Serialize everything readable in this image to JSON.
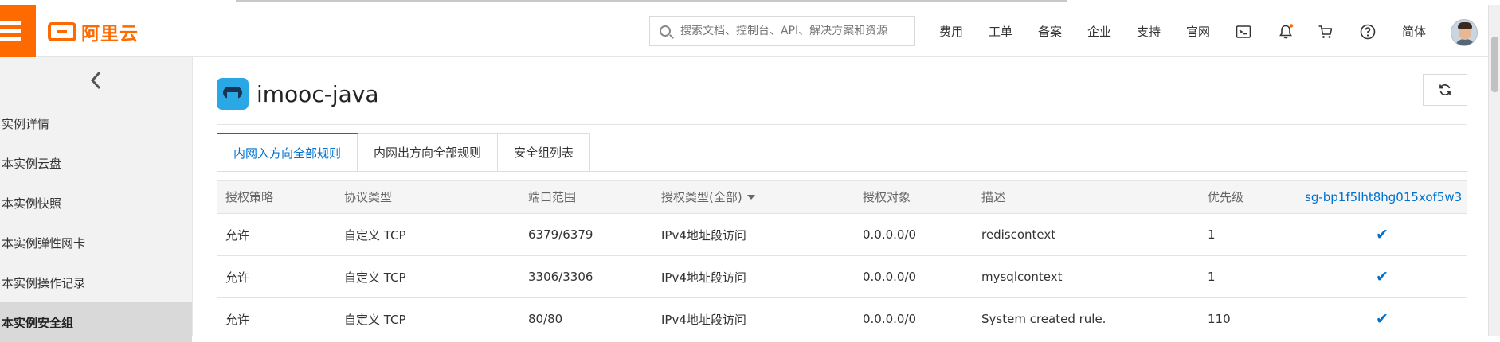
{
  "header": {
    "logo_text": "阿里云",
    "search_placeholder": "搜索文档、控制台、API、解决方案和资源",
    "nav": [
      "费用",
      "工单",
      "备案",
      "企业",
      "支持",
      "官网"
    ],
    "language": "简体",
    "accent_color": "#ff6a00"
  },
  "sidebar": {
    "items": [
      {
        "label": "实例详情"
      },
      {
        "label": "本实例云盘"
      },
      {
        "label": "本实例快照"
      },
      {
        "label": "本实例弹性网卡"
      },
      {
        "label": "本实例操作记录"
      },
      {
        "label": "本实例安全组"
      }
    ]
  },
  "main": {
    "title": "imooc-java",
    "tabs": [
      {
        "label": "内网入方向全部规则"
      },
      {
        "label": "内网出方向全部规则"
      },
      {
        "label": "安全组列表"
      }
    ],
    "table": {
      "headers": [
        "授权策略",
        "协议类型",
        "端口范围",
        "授权类型(全部)",
        "授权对象",
        "描述",
        "优先级",
        "sg-bp1f5lht8hg015xof5w3"
      ],
      "rows": [
        [
          "允许",
          "自定义 TCP",
          "6379/6379",
          "IPv4地址段访问",
          "0.0.0.0/0",
          "rediscontext",
          "1"
        ],
        [
          "允许",
          "自定义 TCP",
          "3306/3306",
          "IPv4地址段访问",
          "0.0.0.0/0",
          "mysqlcontext",
          "1"
        ],
        [
          "允许",
          "自定义 TCP",
          "80/80",
          "IPv4地址段访问",
          "0.0.0.0/0",
          "System created rule.",
          "110"
        ]
      ]
    }
  }
}
